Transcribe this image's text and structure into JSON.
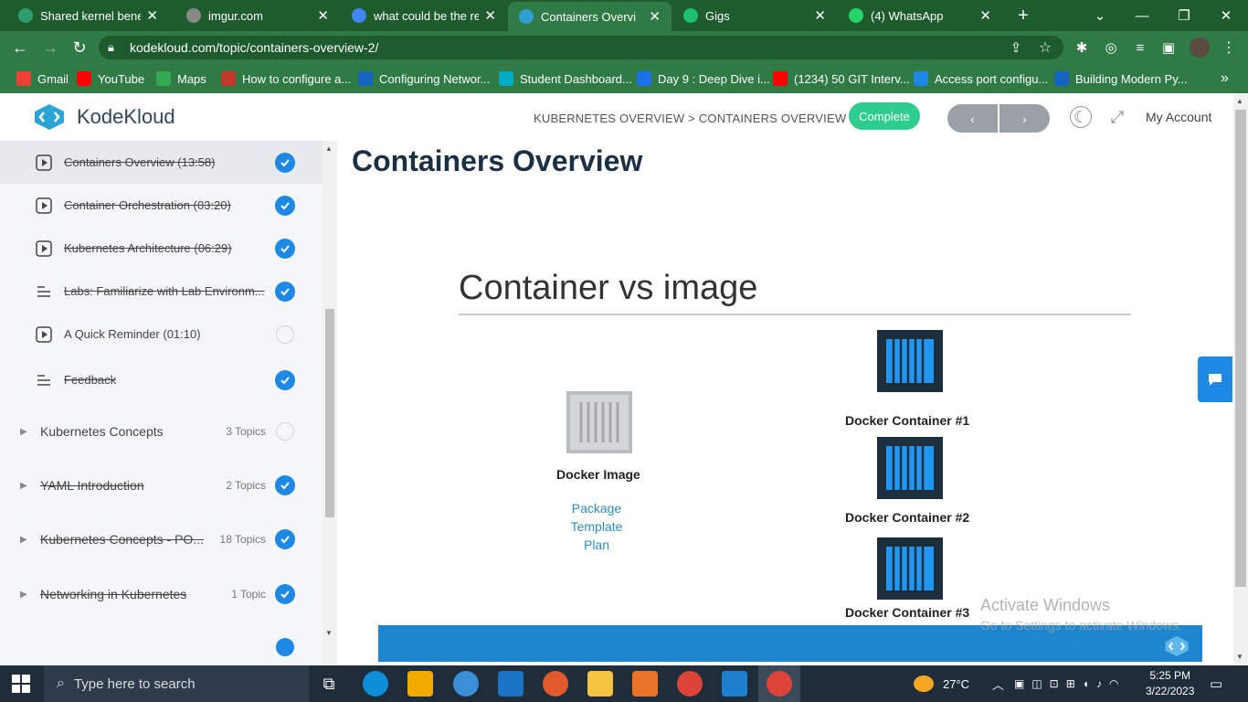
{
  "browser": {
    "tabs": [
      {
        "title": "Shared kernel benefits",
        "color": "#2f9e6f"
      },
      {
        "title": "imgur.com",
        "color": "#888888"
      },
      {
        "title": "what could be the rea",
        "color": "#4285f4"
      },
      {
        "title": "Containers Overvi",
        "color": "#2f9ed1"
      },
      {
        "title": "Gigs",
        "color": "#1dbf73"
      },
      {
        "title": "(4) WhatsApp",
        "color": "#25d366"
      }
    ],
    "new_tab": "+",
    "url": "kodekloud.com/topic/containers-overview-2/",
    "bookmarks": [
      {
        "label": "Gmail",
        "color": "#ea4335"
      },
      {
        "label": "YouTube",
        "color": "#ff0000"
      },
      {
        "label": "Maps",
        "color": "#34a853"
      },
      {
        "label": "How to configure a...",
        "color": "#c0392b"
      },
      {
        "label": "Configuring Networ...",
        "color": "#1565c0"
      },
      {
        "label": "Student Dashboard...",
        "color": "#00acc1"
      },
      {
        "label": "Day 9 : Deep Dive i...",
        "color": "#1a73e8"
      },
      {
        "label": "(1234) 50 GIT Interv...",
        "color": "#ff0000"
      },
      {
        "label": "Access port configu...",
        "color": "#1e88e5"
      },
      {
        "label": "Building Modern Py...",
        "color": "#1565c0"
      }
    ],
    "more_bookmarks": "»"
  },
  "header": {
    "logo_text": "KodeKloud",
    "breadcrumb": "KUBERNETES OVERVIEW > CONTAINERS OVERVIEW",
    "complete_label": "Complete",
    "prev_label": "‹",
    "next_label": "›",
    "account_label": "My Account"
  },
  "sidebar": {
    "lessons": [
      {
        "label": "Containers Overview (13:58)",
        "type": "video",
        "done": true,
        "current": true
      },
      {
        "label": "Container Orchestration (03:20)",
        "type": "video",
        "done": true,
        "current": false
      },
      {
        "label": "Kubernetes Architecture (06:29)",
        "type": "video",
        "done": true,
        "current": false
      },
      {
        "label": "Labs: Familiarize with Lab Environm...",
        "type": "lab",
        "done": true,
        "current": false
      },
      {
        "label": "A Quick Reminder (01:10)",
        "type": "video",
        "done": false,
        "current": false
      },
      {
        "label": "Feedback",
        "type": "lab",
        "done": true,
        "current": false
      }
    ],
    "sections": [
      {
        "label": "Kubernetes Concepts",
        "count": "3 Topics",
        "done": false
      },
      {
        "label": "YAML Introduction",
        "count": "2 Topics",
        "done": true
      },
      {
        "label": "Kubernetes Concepts - PO...",
        "count": "18 Topics",
        "done": true
      },
      {
        "label": "Networking in Kubernetes",
        "count": "1 Topic",
        "done": true
      }
    ]
  },
  "main": {
    "title": "Containers Overview",
    "slide": {
      "heading": "Container vs image",
      "image_label": "Docker Image",
      "image_notes": [
        "Package",
        "Template",
        "Plan"
      ],
      "containers": [
        "Docker Container #1",
        "Docker Container #2",
        "Docker Container #3"
      ]
    },
    "watermark_line1": "Activate Windows",
    "watermark_line2": "Go to Settings to activate Windows."
  },
  "taskbar": {
    "search_placeholder": "Type here to search",
    "weather": "27°C",
    "time": "5:25 PM",
    "date": "3/22/2023"
  }
}
